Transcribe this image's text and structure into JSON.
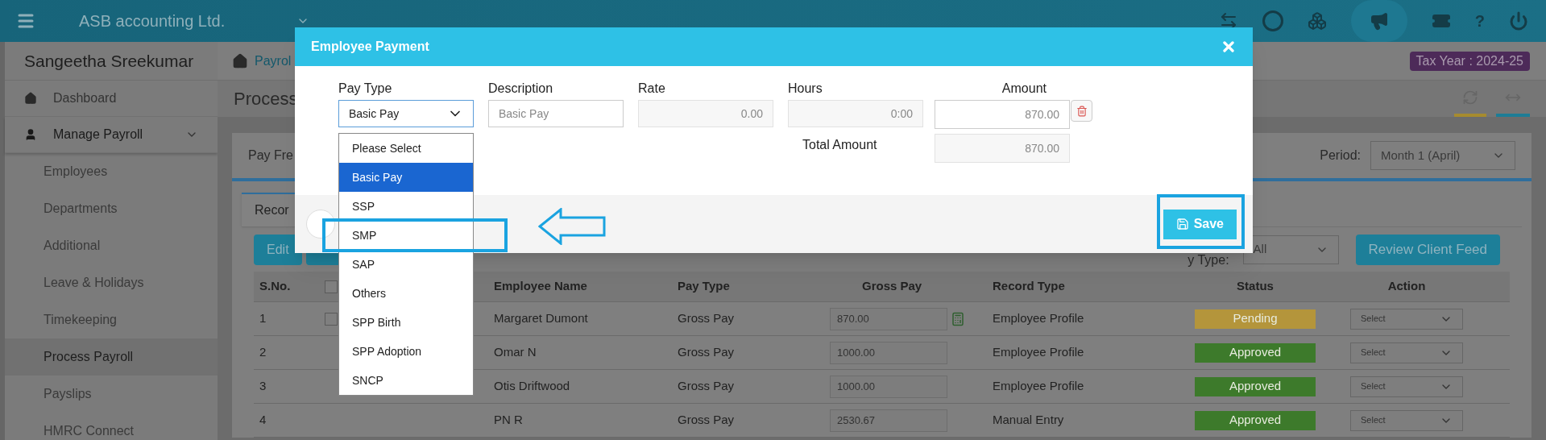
{
  "top_bar": {
    "company": "ASB accounting Ltd.",
    "help_glyph": "?"
  },
  "sidebar": {
    "user": "Sangeetha Sreekumar",
    "items": [
      {
        "label": "Dashboard",
        "kind": "home",
        "selected": false
      },
      {
        "label": "Manage Payroll",
        "kind": "person",
        "selected": false,
        "expanded": true,
        "children": [
          {
            "label": "Employees",
            "selected": false
          },
          {
            "label": "Departments",
            "selected": false
          },
          {
            "label": "Additional",
            "selected": false
          },
          {
            "label": "Leave & Holidays",
            "selected": false
          },
          {
            "label": "Timekeeping",
            "selected": false
          },
          {
            "label": "Process Payroll",
            "selected": true
          },
          {
            "label": "Payslips",
            "selected": false
          },
          {
            "label": "HMRC Connect",
            "selected": false
          }
        ]
      }
    ]
  },
  "breadcrumb": "Payrol",
  "tax_year": "Tax Year : 2024-25",
  "page_title": "Process",
  "filter": {
    "tab": "Pay Fre",
    "period_label": "Period:",
    "period_value": "Month 1 (April)"
  },
  "inner_tab": "Recor",
  "buttons": [
    "Edit"
  ],
  "pay_type_filter": {
    "label": "y Type:",
    "value": "All"
  },
  "review_button": "Review Client Feed",
  "table": {
    "select_all_checked": false,
    "columns": [
      "S.No.",
      "Employee Name",
      "Pay Type",
      "Gross Pay",
      "Record Type",
      "Status",
      "Action"
    ],
    "rows": [
      {
        "sno": "1",
        "checked": false,
        "calculator": true,
        "name": "Margaret Dumont",
        "pay_type": "Gross Pay",
        "gross": "870.00",
        "record_type": "Employee Profile",
        "status": {
          "text": "Pending",
          "color": "#b4953b"
        },
        "action": "Select"
      },
      {
        "sno": "2",
        "name": "Omar N",
        "pay_type": "Gross Pay",
        "gross": "1000.00",
        "record_type": "Employee Profile",
        "status": {
          "text": "Approved",
          "color": "#3d7a2b"
        },
        "action": "Select"
      },
      {
        "sno": "3",
        "name": "Otis Driftwood",
        "pay_type": "Gross Pay",
        "gross": "1000.00",
        "record_type": "Employee Profile",
        "status": {
          "text": "Approved",
          "color": "#3d7a2b"
        },
        "action": "Select"
      },
      {
        "sno": "4",
        "name": "PN R",
        "pay_type": "Gross Pay",
        "gross": "2530.67",
        "record_type": "Manual Entry",
        "status": {
          "text": "Approved",
          "color": "#3d7a2b"
        },
        "action": "Select"
      }
    ]
  },
  "modal": {
    "title": "Employee Payment",
    "pay_type": {
      "label": "Pay Type",
      "value": "Basic Pay",
      "options": [
        {
          "label": "Please Select",
          "selected": false
        },
        {
          "label": "Basic Pay",
          "selected": true
        },
        {
          "label": "SSP",
          "selected": false
        },
        {
          "label": "SMP",
          "selected": false
        },
        {
          "label": "SAP",
          "selected": false
        },
        {
          "label": "Others",
          "selected": false
        },
        {
          "label": "SPP Birth",
          "selected": false
        },
        {
          "label": "SPP Adoption",
          "selected": false
        },
        {
          "label": "SNCP",
          "selected": false
        }
      ]
    },
    "description": {
      "label": "Description",
      "placeholder": "Basic Pay"
    },
    "rate": {
      "label": "Rate",
      "value": "0.00"
    },
    "hours": {
      "label": "Hours",
      "value": "0:00"
    },
    "amount": {
      "label": "Amount",
      "value": "870.00"
    },
    "total": {
      "label": "Total Amount",
      "value": "870.00"
    },
    "save": "Save"
  }
}
